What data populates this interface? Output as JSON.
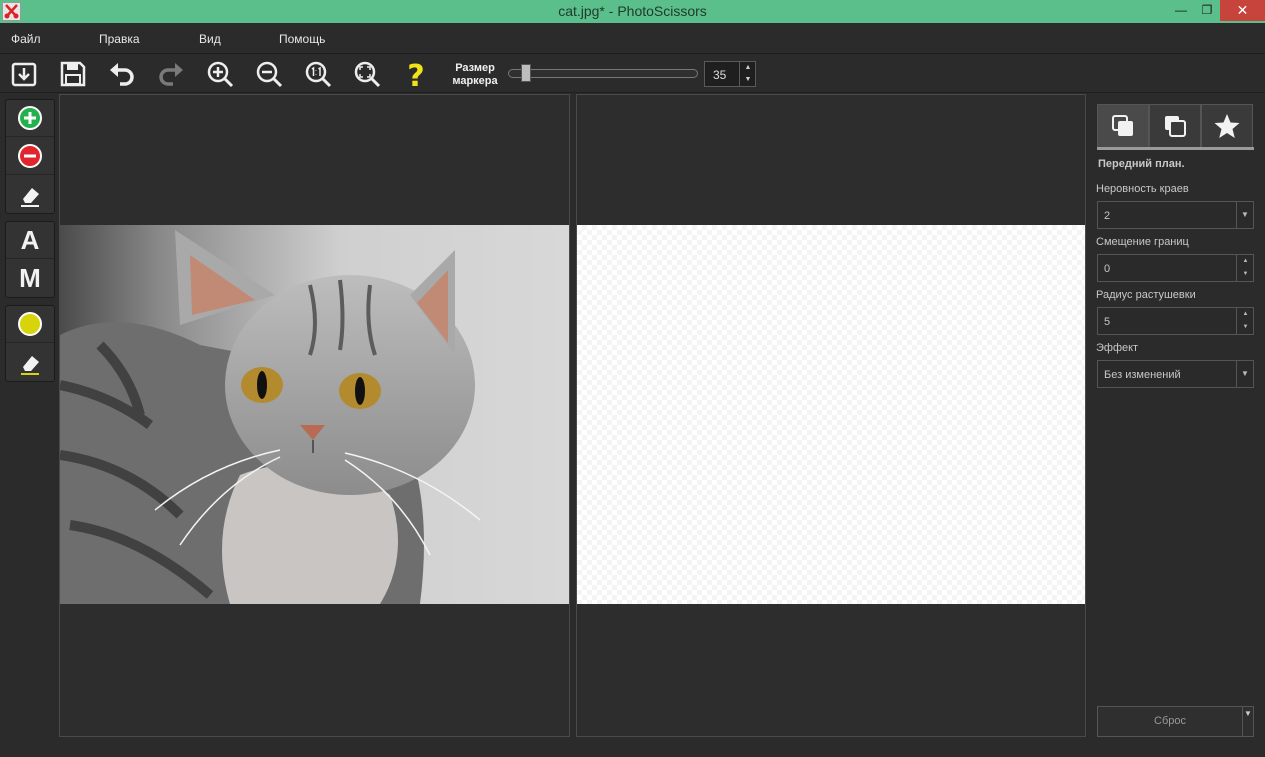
{
  "window": {
    "title": "cat.jpg* - PhotoScissors",
    "minimize": "—",
    "maximize": "❐",
    "close": "✕"
  },
  "menu": {
    "items": [
      "Файл",
      "Правка",
      "Вид",
      "Помощь"
    ]
  },
  "toolbar": {
    "marker_label_line1": "Размер",
    "marker_label_line2": "маркера",
    "marker_size": "35",
    "marker_slider_fraction": 0.05,
    "help_glyph": "?"
  },
  "left_tools": {
    "auto_tool": "A",
    "manual_tool": "M"
  },
  "right_panel": {
    "section_title": "Передний план.",
    "edge_roughness": {
      "label": "Неровность краев",
      "value": "2"
    },
    "border_offset": {
      "label": "Смещение границ",
      "value": "0"
    },
    "feather_radius": {
      "label": "Радиус растушевки",
      "value": "5"
    },
    "effect": {
      "label": "Эффект",
      "value": "Без изменений"
    },
    "reset_label": "Сброс"
  },
  "colors": {
    "titlebar": "#5bbf8c",
    "add_marker": "#22b14c",
    "remove_marker": "#e0262c",
    "hair_marker": "#d7d40c",
    "help": "#f2e21a"
  },
  "icons": {
    "open": "open-icon",
    "save": "save-icon",
    "undo": "undo-icon",
    "redo": "redo-icon",
    "zoom_in": "zoom-in-icon",
    "zoom_out": "zoom-out-icon",
    "zoom_actual": "zoom-actual-size-icon",
    "zoom_fit": "zoom-fit-icon",
    "help": "help-icon"
  }
}
